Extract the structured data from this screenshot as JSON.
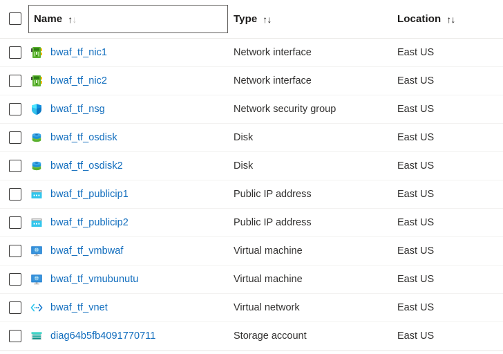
{
  "table": {
    "select_all_checkbox": {
      "name": "select-all-checkbox",
      "checked": false
    },
    "columns": [
      {
        "key": "name",
        "label": "Name",
        "sort_icon": "sort-arrows-icon",
        "focused": true
      },
      {
        "key": "type",
        "label": "Type",
        "sort_icon": "sort-arrows-icon",
        "focused": false
      },
      {
        "key": "location",
        "label": "Location",
        "sort_icon": "sort-arrows-icon",
        "focused": false
      }
    ],
    "sort_arrow_up": "↑",
    "sort_arrow_down": "↓",
    "rows": [
      {
        "name": "bwaf_tf_nic1",
        "type": "Network interface",
        "location": "East US",
        "icon": "network-interface-icon",
        "checked": false
      },
      {
        "name": "bwaf_tf_nic2",
        "type": "Network interface",
        "location": "East US",
        "icon": "network-interface-icon",
        "checked": false
      },
      {
        "name": "bwaf_tf_nsg",
        "type": "Network security group",
        "location": "East US",
        "icon": "network-security-group-icon",
        "checked": false
      },
      {
        "name": "bwaf_tf_osdisk",
        "type": "Disk",
        "location": "East US",
        "icon": "disk-icon",
        "checked": false
      },
      {
        "name": "bwaf_tf_osdisk2",
        "type": "Disk",
        "location": "East US",
        "icon": "disk-icon",
        "checked": false
      },
      {
        "name": "bwaf_tf_publicip1",
        "type": "Public IP address",
        "location": "East US",
        "icon": "public-ip-address-icon",
        "checked": false
      },
      {
        "name": "bwaf_tf_publicip2",
        "type": "Public IP address",
        "location": "East US",
        "icon": "public-ip-address-icon",
        "checked": false
      },
      {
        "name": "bwaf_tf_vmbwaf",
        "type": "Virtual machine",
        "location": "East US",
        "icon": "virtual-machine-icon",
        "checked": false
      },
      {
        "name": "bwaf_tf_vmubunutu",
        "type": "Virtual machine",
        "location": "East US",
        "icon": "virtual-machine-icon",
        "checked": false
      },
      {
        "name": "bwaf_tf_vnet",
        "type": "Virtual network",
        "location": "East US",
        "icon": "virtual-network-icon",
        "checked": false
      },
      {
        "name": "diag64b5fb4091770711",
        "type": "Storage account",
        "location": "East US",
        "icon": "storage-account-icon",
        "checked": false
      }
    ]
  },
  "colors": {
    "link": "#0f6cbd",
    "text": "#323130",
    "header_text": "#1b1a19",
    "row_divider": "#f3f2f1",
    "header_divider": "#edebe9",
    "focus_outline": "#605e5c",
    "checkbox_border": "#3b3a39"
  }
}
